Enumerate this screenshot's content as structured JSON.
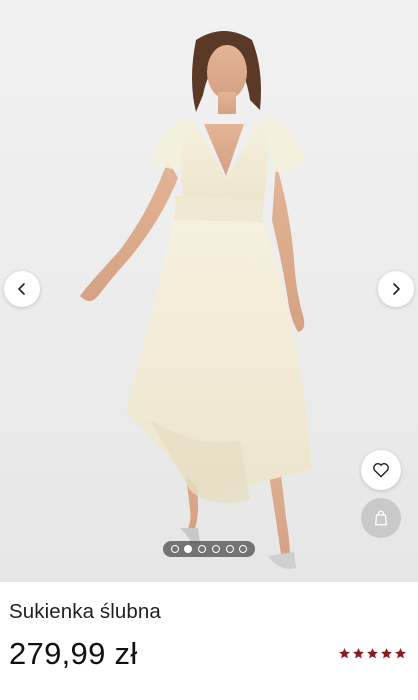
{
  "product": {
    "title": "Sukienka ślubna",
    "price": "279,99 zł",
    "rating": {
      "value": 5,
      "max": 5
    }
  },
  "gallery": {
    "image_count": 6,
    "active_index": 1,
    "prev_icon": "chevron-left-icon",
    "next_icon": "chevron-right-icon"
  },
  "actions": {
    "wishlist_icon": "heart-icon",
    "cart_icon": "shopping-bag-icon"
  },
  "colors": {
    "star": "#8b1a22",
    "dots_bg": "#464646",
    "cart_button_bg": "#c9c9c9"
  }
}
